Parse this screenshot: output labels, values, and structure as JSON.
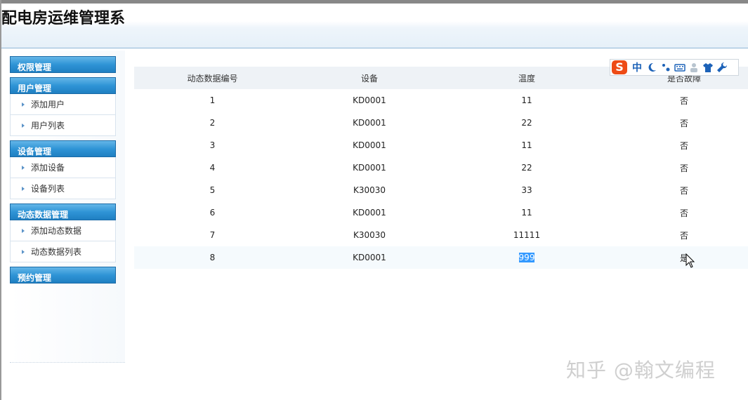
{
  "app": {
    "title": "配电房运维管理系"
  },
  "sidebar": {
    "groups": [
      {
        "label": "权限管理",
        "items": []
      },
      {
        "label": "用户管理",
        "items": [
          {
            "label": "添加用户"
          },
          {
            "label": "用户列表"
          }
        ]
      },
      {
        "label": "设备管理",
        "items": [
          {
            "label": "添加设备"
          },
          {
            "label": "设备列表"
          }
        ]
      },
      {
        "label": "动态数据管理",
        "items": [
          {
            "label": "添加动态数据"
          },
          {
            "label": "动态数据列表"
          }
        ]
      },
      {
        "label": "预约管理",
        "items": []
      }
    ]
  },
  "table": {
    "columns": [
      "动态数据编号",
      "设备",
      "温度",
      "是否故障"
    ],
    "rows": [
      [
        "1",
        "KD0001",
        "11",
        "否"
      ],
      [
        "2",
        "KD0001",
        "22",
        "否"
      ],
      [
        "3",
        "KD0001",
        "11",
        "否"
      ],
      [
        "4",
        "KD0001",
        "22",
        "否"
      ],
      [
        "5",
        "K30030",
        "33",
        "否"
      ],
      [
        "6",
        "KD0001",
        "11",
        "否"
      ],
      [
        "7",
        "K30030",
        "11111",
        "否"
      ],
      [
        "8",
        "KD0001",
        "999",
        "是"
      ]
    ]
  },
  "ime_toolbar": {
    "logo": "S",
    "mode": "中",
    "icons": [
      "moon-icon",
      "punctuation-icon",
      "keyboard-icon",
      "user-icon",
      "shirt-icon",
      "wrench-icon"
    ]
  },
  "watermark": {
    "text": "知乎 @翰文编程"
  },
  "colors": {
    "menu_header": "#2f94d6",
    "ime_logo": "#ee4b16",
    "selection": "#3399ff"
  }
}
